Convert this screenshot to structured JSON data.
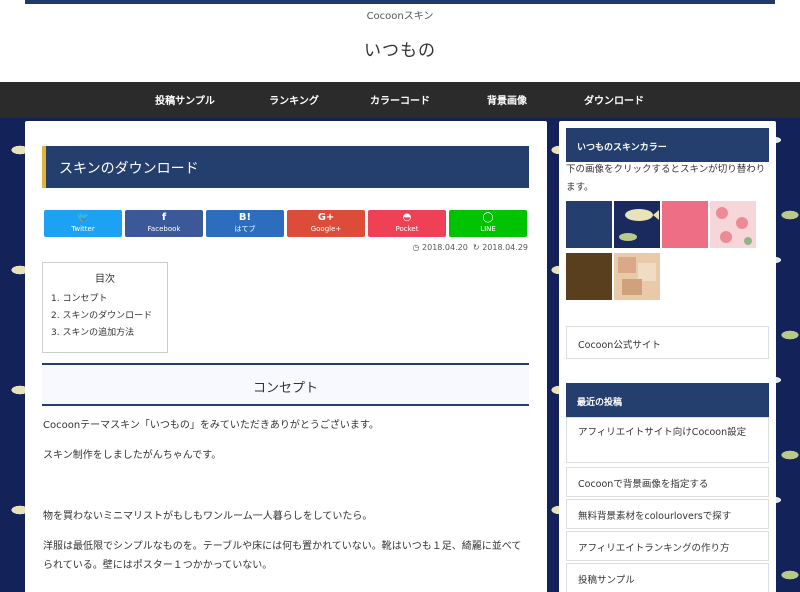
{
  "header": {
    "tagline": "Cocoonスキン",
    "site_title": "いつもの"
  },
  "nav": {
    "items": [
      "投稿サンプル",
      "ランキング",
      "カラーコード",
      "背景画像",
      "ダウンロード"
    ]
  },
  "article": {
    "title": "スキンのダウンロード",
    "share": [
      {
        "icon": "twitter-icon",
        "glyph": "🐦",
        "label": "Twitter",
        "color": "#1da1f2"
      },
      {
        "icon": "facebook-icon",
        "glyph": "f",
        "label": "Facebook",
        "color": "#3b5998"
      },
      {
        "icon": "hatebu-icon",
        "glyph": "B!",
        "label": "はてブ",
        "color": "#2c6ebd"
      },
      {
        "icon": "googleplus-icon",
        "glyph": "G+",
        "label": "Google+",
        "color": "#dd4b39"
      },
      {
        "icon": "pocket-icon",
        "glyph": "◓",
        "label": "Pocket",
        "color": "#ef4056"
      },
      {
        "icon": "line-icon",
        "glyph": "◯",
        "label": "LINE",
        "color": "#00c300"
      }
    ],
    "date_posted": "2018.04.20",
    "date_updated": "2018.04.29",
    "toc": {
      "title": "目次",
      "items": [
        "1. コンセプト",
        "2. スキンのダウンロード",
        "3. スキンの追加方法"
      ]
    },
    "section_heading": "コンセプト",
    "paragraphs": [
      "Cocoonテーマスキン「いつもの」をみていただきありがとうございます。",
      "スキン制作をしましたがんちゃんです。",
      "物を買わないミニマリストがもしもワンルーム一人暮らしをしていたら。",
      "洋服は最低限でシンプルなものを。テーブルや床には何も置かれていない。靴はいつも１足、綺麗に並べてられている。壁にはポスター１つかかっていない。"
    ]
  },
  "sidebar": {
    "color_widget_title": "いつものスキンカラー",
    "color_widget_desc": "下の画像をクリックするとスキンが切り替わります。",
    "swatches": [
      {
        "name": "navy-swatch",
        "color": "#243e6e"
      },
      {
        "name": "fish-pattern-swatch",
        "color": "#1a2a5e"
      },
      {
        "name": "pink-swatch",
        "color": "#ee6f85"
      },
      {
        "name": "rose-pattern-swatch",
        "color": "#f6d6d8"
      },
      {
        "name": "brown-swatch",
        "color": "#5a3f1f"
      },
      {
        "name": "collage-pattern-swatch",
        "color": "#e9c9a8"
      }
    ],
    "cocoon_link": "Cocoon公式サイト",
    "recent_title": "最近の投稿",
    "recent_posts": [
      "アフィリエイトサイト向けCocoon設定",
      "Cocoonで背景画像を指定する",
      "無料背景素材をcolourloversで探す",
      "アフィリエイトランキングの作り方",
      "投稿サンプル"
    ]
  }
}
